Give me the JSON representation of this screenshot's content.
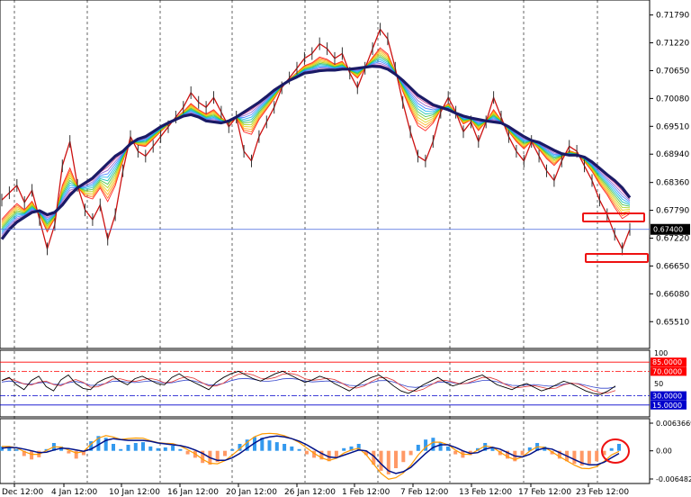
{
  "chart_data": {
    "type": "line",
    "main": {
      "ylim": [
        0.6498,
        0.7206
      ],
      "price_ticks": [
        "0.71790",
        "0.71220",
        "0.70650",
        "0.70080",
        "0.69510",
        "0.68940",
        "0.68360",
        "0.67790",
        "0.67220",
        "0.66650",
        "0.66080",
        "0.65510"
      ],
      "current_price": "0.67400",
      "current_value": 0.674,
      "price_series": [
        0.68,
        0.6815,
        0.683,
        0.6795,
        0.682,
        0.676,
        0.67,
        0.675,
        0.687,
        0.692,
        0.683,
        0.678,
        0.676,
        0.679,
        0.672,
        0.677,
        0.686,
        0.693,
        0.69,
        0.689,
        0.691,
        0.693,
        0.695,
        0.697,
        0.699,
        0.702,
        0.7,
        0.699,
        0.701,
        0.698,
        0.695,
        0.697,
        0.69,
        0.688,
        0.693,
        0.696,
        0.699,
        0.703,
        0.705,
        0.707,
        0.709,
        0.71,
        0.712,
        0.711,
        0.709,
        0.71,
        0.706,
        0.703,
        0.707,
        0.711,
        0.715,
        0.713,
        0.707,
        0.7,
        0.694,
        0.689,
        0.688,
        0.692,
        0.698,
        0.701,
        0.698,
        0.694,
        0.696,
        0.692,
        0.696,
        0.701,
        0.697,
        0.693,
        0.69,
        0.688,
        0.692,
        0.689,
        0.686,
        0.684,
        0.688,
        0.691,
        0.69,
        0.687,
        0.684,
        0.68,
        0.677,
        0.673,
        0.67,
        0.674
      ],
      "slow_ma": [
        0.672,
        0.674,
        0.6755,
        0.6765,
        0.6775,
        0.6778,
        0.677,
        0.6775,
        0.679,
        0.681,
        0.6825,
        0.6835,
        0.6845,
        0.686,
        0.6875,
        0.689,
        0.69,
        0.6915,
        0.6925,
        0.693,
        0.694,
        0.695,
        0.6958,
        0.6965,
        0.6972,
        0.6975,
        0.697,
        0.6962,
        0.696,
        0.6958,
        0.6962,
        0.697,
        0.698,
        0.699,
        0.7,
        0.7012,
        0.7025,
        0.7035,
        0.7045,
        0.7052,
        0.706,
        0.7062,
        0.7065,
        0.7066,
        0.7066,
        0.7068,
        0.7068,
        0.707,
        0.7072,
        0.7074,
        0.7073,
        0.7068,
        0.7058,
        0.7045,
        0.703,
        0.7015,
        0.7005,
        0.6995,
        0.699,
        0.6985,
        0.6978,
        0.6972,
        0.6968,
        0.6965,
        0.6962,
        0.696,
        0.6958,
        0.695,
        0.694,
        0.693,
        0.6922,
        0.6918,
        0.691,
        0.6902,
        0.6895,
        0.6892,
        0.6892,
        0.6888,
        0.6878,
        0.6865,
        0.6852,
        0.684,
        0.6825,
        0.6805
      ]
    },
    "rsi": {
      "range": [
        0,
        100
      ],
      "ticks": [
        "100",
        "50"
      ],
      "levels": [
        85,
        70,
        30,
        15
      ],
      "level_labels": [
        "85.0000",
        "70.0000",
        "30.0000",
        "15.0000"
      ],
      "series": [
        55,
        60,
        48,
        40,
        55,
        62,
        45,
        38,
        56,
        64,
        50,
        42,
        40,
        52,
        58,
        62,
        54,
        48,
        58,
        62,
        56,
        50,
        48,
        60,
        66,
        58,
        52,
        46,
        40,
        52,
        60,
        66,
        70,
        64,
        58,
        54,
        60,
        66,
        70,
        64,
        58,
        52,
        56,
        62,
        58,
        50,
        44,
        38,
        46,
        54,
        60,
        64,
        56,
        46,
        38,
        34,
        40,
        48,
        54,
        60,
        52,
        46,
        50,
        56,
        60,
        64,
        56,
        48,
        44,
        40,
        46,
        50,
        44,
        38,
        42,
        48,
        54,
        50,
        44,
        38,
        34,
        32,
        38,
        46
      ]
    },
    "macd": {
      "ylim": [
        -0.0064829,
        0.0063669
      ],
      "ticks": [
        "0.0063669",
        "0.00",
        "-0.0064829"
      ],
      "histogram": [
        0.001,
        0.0008,
        0.0004,
        -0.0012,
        -0.002,
        -0.0015,
        0.0004,
        0.0018,
        0.001,
        -0.0006,
        -0.0018,
        -0.001,
        0.0022,
        0.0034,
        0.003,
        0.0016,
        0.0004,
        0.0014,
        0.0018,
        0.002,
        0.001,
        0.0006,
        0.0008,
        0.0012,
        0.0004,
        -0.0008,
        -0.0016,
        -0.0028,
        -0.0032,
        -0.0026,
        -0.0012,
        0.0004,
        0.0016,
        0.0026,
        0.0032,
        0.003,
        0.0024,
        0.002,
        0.0016,
        0.001,
        0.0004,
        -0.0008,
        -0.0016,
        -0.002,
        -0.0024,
        -0.0014,
        0.0006,
        0.001,
        0.0016,
        -0.001,
        -0.0032,
        -0.0046,
        -0.0054,
        -0.004,
        -0.0026,
        -0.001,
        0.0014,
        0.0026,
        0.003,
        0.002,
        0.001,
        -0.0008,
        -0.0016,
        -0.001,
        0.0006,
        0.0018,
        0.0008,
        -0.001,
        -0.0018,
        -0.0024,
        -0.001,
        0.0008,
        0.0018,
        0.001,
        -0.0008,
        -0.0018,
        -0.0024,
        -0.003,
        -0.0034,
        -0.003,
        -0.0024,
        -0.001,
        0.0006,
        0.0016
      ],
      "signal": [
        0.0006,
        0.0008,
        0.0007,
        0.0004,
        0.0,
        -0.0004,
        -0.0003,
        0.0002,
        0.0006,
        0.0005,
        0.0002,
        -0.0001,
        0.0004,
        0.0014,
        0.0024,
        0.0028,
        0.0026,
        0.0024,
        0.0024,
        0.0024,
        0.0022,
        0.0018,
        0.0016,
        0.0014,
        0.0012,
        0.0008,
        0.0002,
        -0.0006,
        -0.0016,
        -0.0022,
        -0.0022,
        -0.0016,
        -0.0006,
        0.0006,
        0.0018,
        0.0028,
        0.0032,
        0.0034,
        0.0032,
        0.0028,
        0.0022,
        0.0014,
        0.0004,
        -0.0006,
        -0.0014,
        -0.0016,
        -0.001,
        -0.0004,
        0.0002,
        0.0,
        -0.0012,
        -0.003,
        -0.0046,
        -0.0052,
        -0.0048,
        -0.0038,
        -0.0022,
        -0.0006,
        0.0008,
        0.0014,
        0.0014,
        0.0008,
        0.0,
        -0.0006,
        -0.0004,
        0.0004,
        0.0008,
        0.0004,
        -0.0004,
        -0.0012,
        -0.0014,
        -0.0008,
        0.0002,
        0.0006,
        0.0004,
        -0.0004,
        -0.0012,
        -0.002,
        -0.0028,
        -0.0032,
        -0.0032,
        -0.0026,
        -0.0016,
        -0.0006
      ]
    },
    "x_labels": [
      "Dec 12:00",
      "4 Jan 12:00",
      "10 Jan 12:00",
      "16 Jan 12:00",
      "20 Jan 12:00",
      "26 Jan 12:00",
      "1 Feb 12:00",
      "7 Feb 12:00",
      "13 Feb 12:00",
      "17 Feb 12:00",
      "23 Feb 12:00"
    ],
    "colors": {
      "price_line": "#cc1111",
      "slow_ma": "#1a1a66",
      "current_price_line": "#4466dd",
      "rsi_line": "#000000",
      "rsi_level_high": "#ff0000",
      "rsi_level_low": "#0000cc",
      "macd_hist_up": "#3399ee",
      "macd_hist_down": "#ff9966",
      "macd_signal": "#001188",
      "highlight": "#ee1111"
    }
  }
}
